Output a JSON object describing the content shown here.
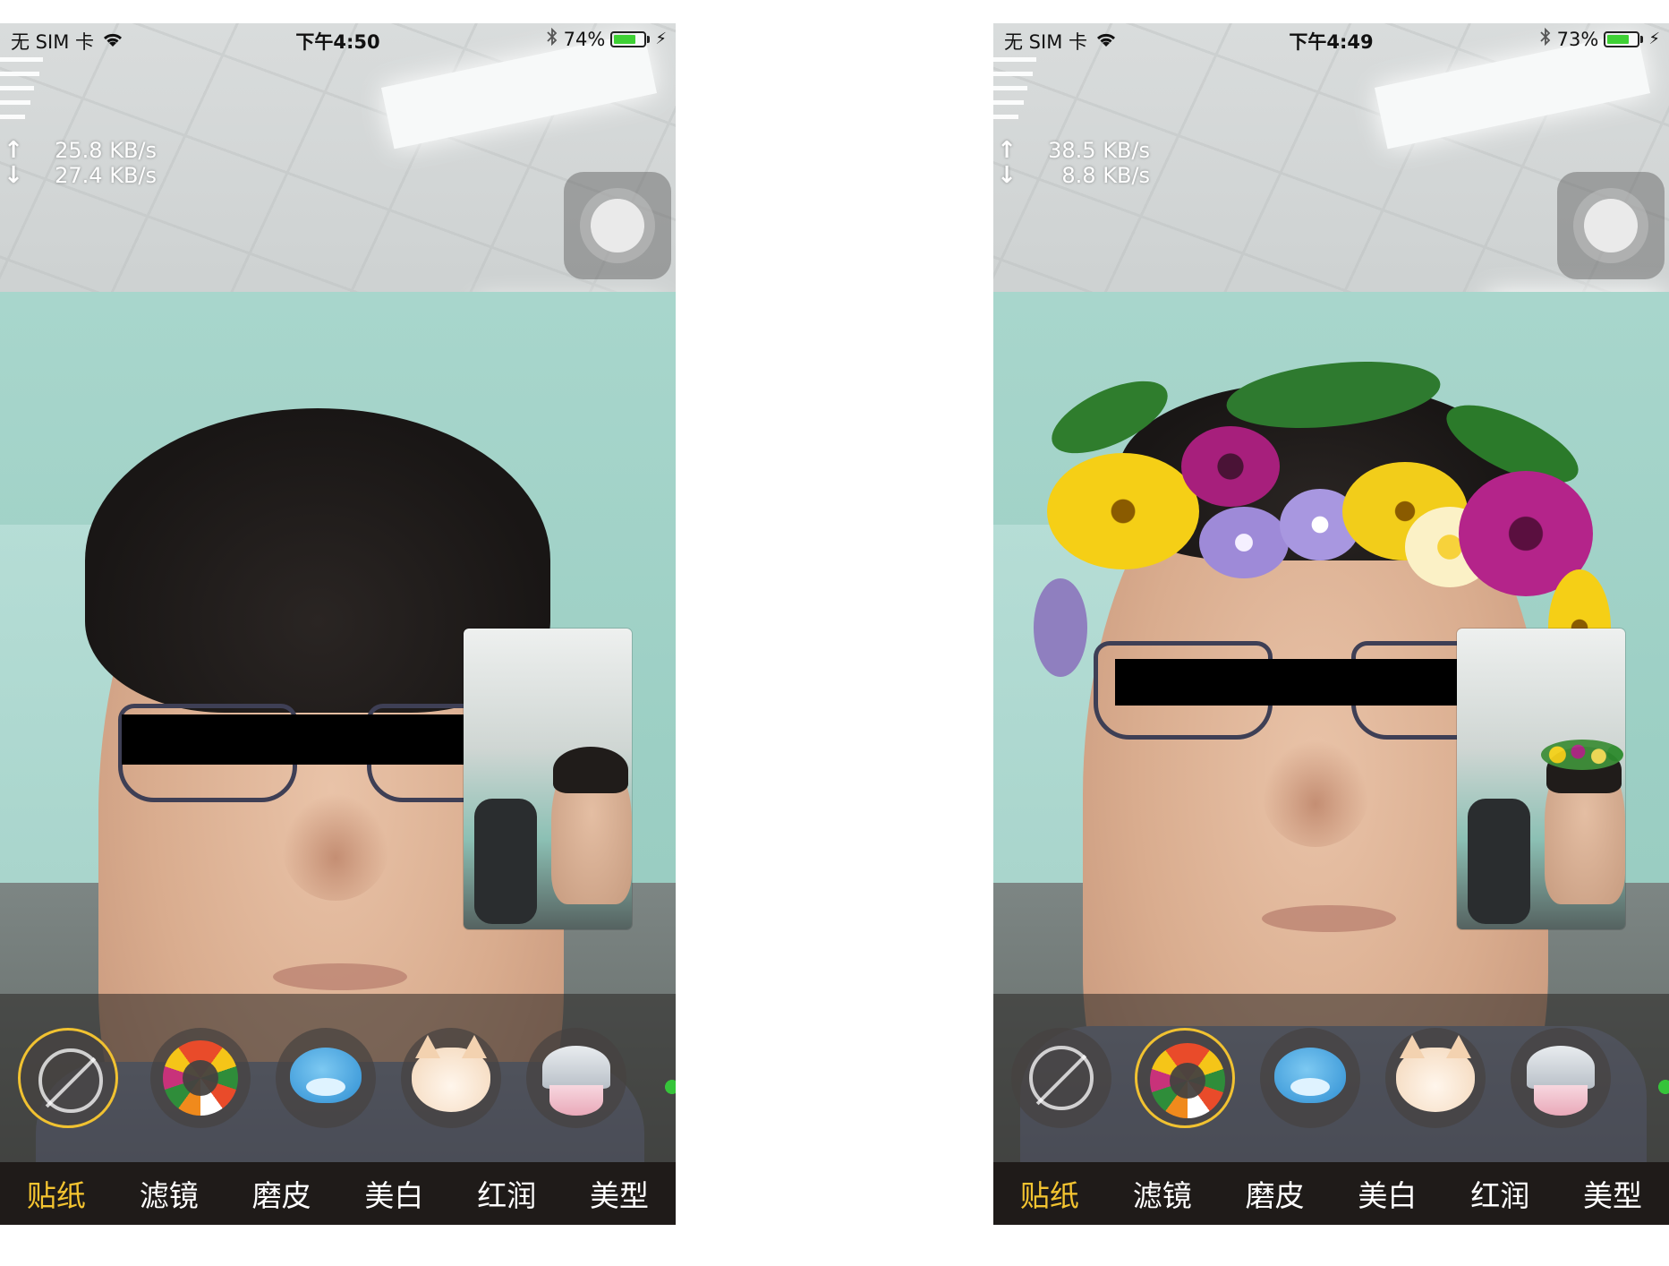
{
  "screens": [
    {
      "status": {
        "carrier": "无 SIM 卡",
        "time": "下午4:50",
        "battery_text": "74%",
        "battery_level": 0.74
      },
      "net": {
        "upload": "25.8 KB/s",
        "download": "27.4 KB/s"
      },
      "selected_sticker": "none",
      "tabs": [
        "贴纸",
        "滤镜",
        "磨皮",
        "美白",
        "红润",
        "美型"
      ],
      "active_tab": "贴纸"
    },
    {
      "status": {
        "carrier": "无 SIM 卡",
        "time": "下午4:49",
        "battery_text": "73%",
        "battery_level": 0.73
      },
      "net": {
        "upload": "38.5 KB/s",
        "download": "8.8 KB/s"
      },
      "selected_sticker": "flower-wreath",
      "tabs": [
        "贴纸",
        "滤镜",
        "磨皮",
        "美白",
        "红润",
        "美型"
      ],
      "active_tab": "贴纸"
    }
  ],
  "stickers": [
    "none-icon",
    "flower-wreath-icon",
    "dolphin-icon",
    "cat-icon",
    "tiara-icon"
  ],
  "colors": {
    "accent": "#f4c430",
    "battery": "#3ed134",
    "tab_bar": "#1f1b19"
  },
  "icons": {
    "wifi": "wifi-icon",
    "bluetooth": "bluetooth-icon",
    "charging": "bolt-icon"
  }
}
